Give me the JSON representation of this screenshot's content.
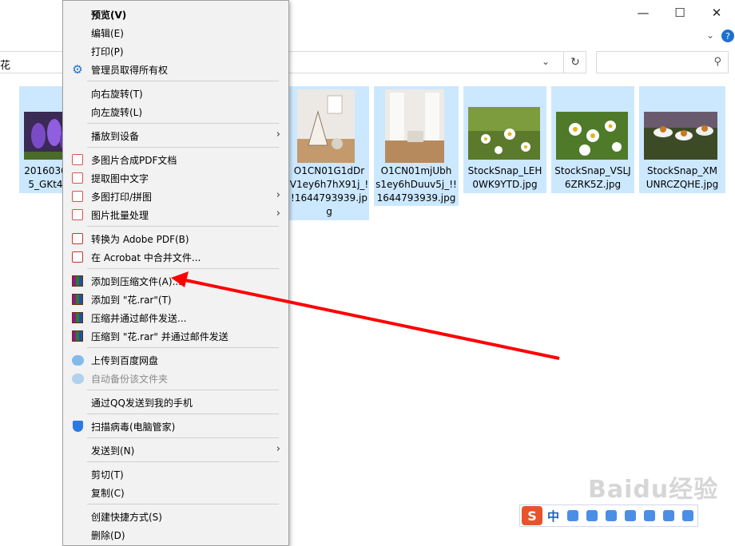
{
  "window": {
    "address_text": "花",
    "minimize": "—",
    "maximize": "☐",
    "close": "✕"
  },
  "files": [
    {
      "name": "2016030\n5_GKt4",
      "thumb": "purple-crocus"
    },
    {
      "name": "O1CN01G1dDr\nV1ey6h7hX91j_!\n!1644793939.jp\ng",
      "thumb": "teepee-room"
    },
    {
      "name": "O1CN01mjUbh\ns1ey6hDuuv5j_!!\n1644793939.jpg",
      "thumb": "white-room"
    },
    {
      "name": "StockSnap_LEH\n0WK9YTD.jpg",
      "thumb": "daisies"
    },
    {
      "name": "StockSnap_VSLJ\n6ZRK5Z.jpg",
      "thumb": "daisies"
    },
    {
      "name": "StockSnap_XM\nUNRCZQHE.jpg",
      "thumb": "coneflowers"
    }
  ],
  "menu": {
    "preview": "预览(V)",
    "edit": "编辑(E)",
    "print": "打印(P)",
    "admin_own": "管理员取得所有权",
    "rotate_right": "向右旋转(T)",
    "rotate_left": "向左旋转(L)",
    "play_to": "播放到设备",
    "merge_pdf": "多图片合成PDF文档",
    "extract_text": "提取图中文字",
    "multi_print": "多图打印/拼图",
    "batch": "图片批量处理",
    "to_pdf": "转换为 Adobe PDF(B)",
    "acrobat_merge": "在 Acrobat 中合并文件...",
    "add_archive": "添加到压缩文件(A)...",
    "add_rar": "添加到 \"花.rar\"(T)",
    "compress_email": "压缩并通过邮件发送...",
    "compress_rar_email": "压缩到 \"花.rar\" 并通过邮件发送",
    "upload_baidu": "上传到百度网盘",
    "auto_backup": "自动备份该文件夹",
    "qq_send": "通过QQ发送到我的手机",
    "scan_virus": "扫描病毒(电脑管家)",
    "send_to": "发送到(N)",
    "cut": "剪切(T)",
    "copy": "复制(C)",
    "shortcut": "创建快捷方式(S)",
    "delete": "删除(D)"
  },
  "ime": {
    "lang": "中"
  },
  "watermark": "Baidu经验",
  "colors": {
    "selection": "#cce8ff",
    "arrow": "#ff0000",
    "menu_bg": "#f2f2f2"
  }
}
